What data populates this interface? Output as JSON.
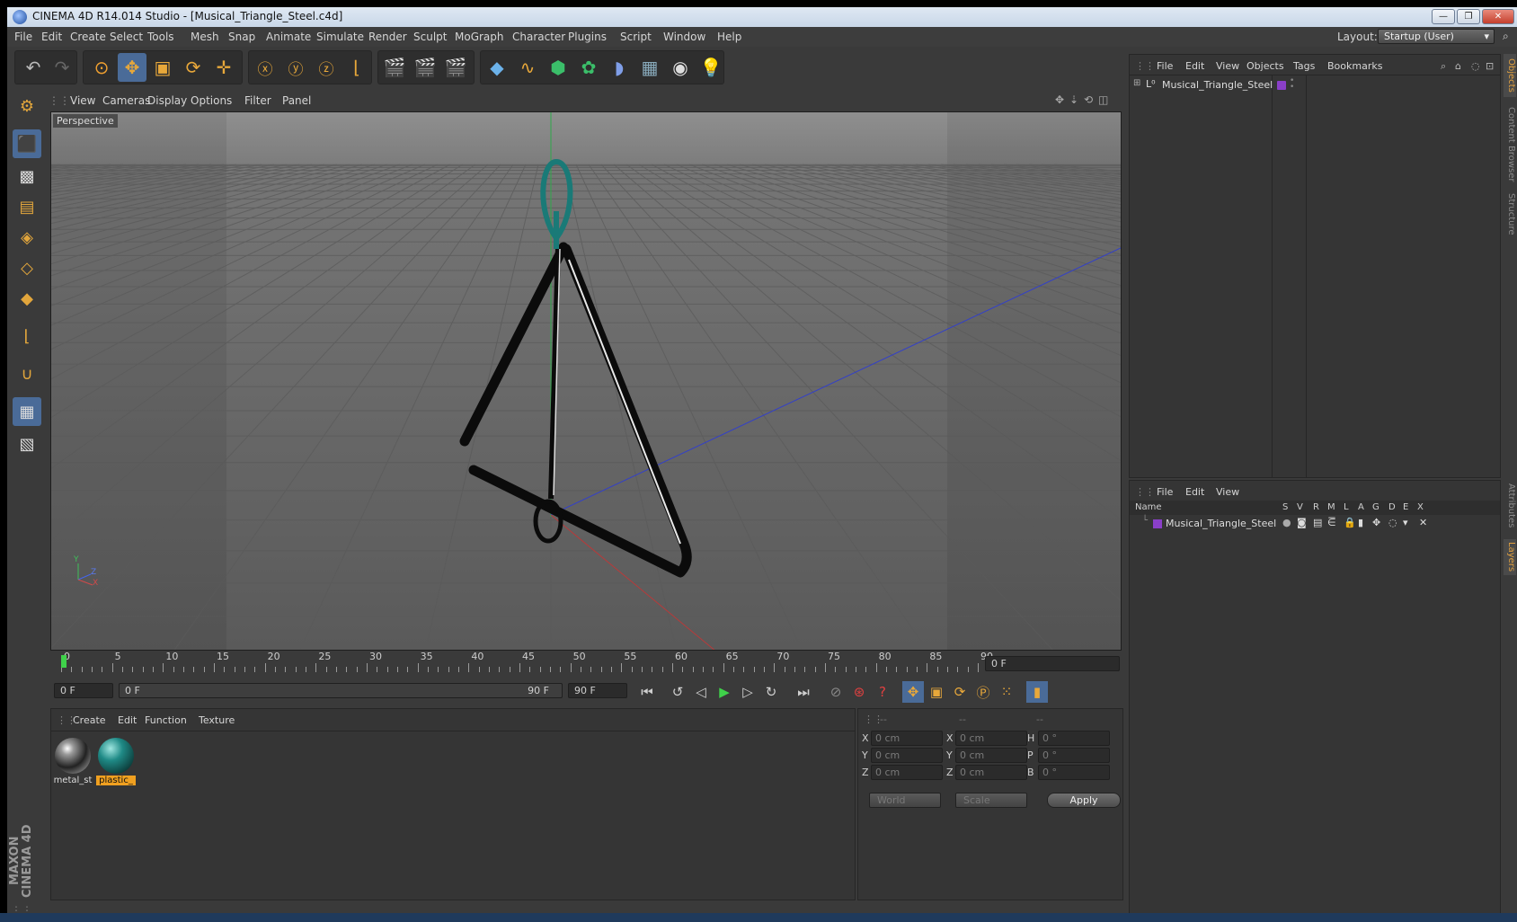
{
  "window": {
    "title": "CINEMA 4D R14.014 Studio - [Musical_Triangle_Steel.c4d]",
    "btn_min": "—",
    "btn_max": "❐",
    "btn_close": "✕"
  },
  "menu": [
    "File",
    "Edit",
    "Create",
    "Select",
    "Tools",
    "Mesh",
    "Snap",
    "Animate",
    "Simulate",
    "Render",
    "Sculpt",
    "MoGraph",
    "Character",
    "Plugins",
    "Script",
    "Window",
    "Help"
  ],
  "layout": {
    "label": "Layout:",
    "value": "Startup (User)"
  },
  "viewport": {
    "menu": [
      "View",
      "Cameras",
      "Display",
      "Options",
      "Filter",
      "Panel"
    ],
    "label": "Perspective",
    "axis_y": "Y",
    "axis_z": "Z",
    "axis_x": "X"
  },
  "timeline": {
    "ticks": [
      "0",
      "5",
      "10",
      "15",
      "20",
      "25",
      "30",
      "35",
      "40",
      "45",
      "50",
      "55",
      "60",
      "65",
      "70",
      "75",
      "80",
      "85",
      "90"
    ],
    "current_frame": "0 F",
    "start": "0 F",
    "range_start": "0 F",
    "range_end": "90 F",
    "end": "90 F"
  },
  "material_panel": {
    "menu": [
      "Create",
      "Edit",
      "Function",
      "Texture"
    ],
    "materials": [
      {
        "name": "metal_st",
        "selected": false
      },
      {
        "name": "plastic_",
        "selected": true
      }
    ]
  },
  "coords": {
    "headers": [
      "--",
      "--",
      "--"
    ],
    "rows": [
      {
        "l1": "X",
        "v1": "0 cm",
        "l2": "X",
        "v2": "0 cm",
        "l3": "H",
        "v3": "0 °"
      },
      {
        "l1": "Y",
        "v1": "0 cm",
        "l2": "Y",
        "v2": "0 cm",
        "l3": "P",
        "v3": "0 °"
      },
      {
        "l1": "Z",
        "v1": "0 cm",
        "l2": "Z",
        "v2": "0 cm",
        "l3": "B",
        "v3": "0 °"
      }
    ],
    "mode1": "World",
    "mode2": "Scale",
    "apply": "Apply"
  },
  "objects_panel": {
    "menu": [
      "File",
      "Edit",
      "View",
      "Objects",
      "Tags",
      "Bookmarks"
    ],
    "items": [
      {
        "name": "Musical_Triangle_Steel"
      }
    ]
  },
  "layers_panel": {
    "menu": [
      "File",
      "Edit",
      "View"
    ],
    "columns": [
      "Name",
      "S",
      "V",
      "R",
      "M",
      "L",
      "A",
      "G",
      "D",
      "E",
      "X"
    ],
    "items": [
      {
        "name": "Musical_Triangle_Steel"
      }
    ]
  },
  "side_tabs": [
    "Objects",
    "Content Browser",
    "Structure",
    "Attributes",
    "Layers"
  ],
  "branding": "MAXON CINEMA 4D",
  "colors": {
    "accent_blue": "#4a6b98",
    "accent_orange": "#e8a83a",
    "triangle_hanger": "#1f8a86",
    "layer_purple": "#8a3fc8"
  }
}
